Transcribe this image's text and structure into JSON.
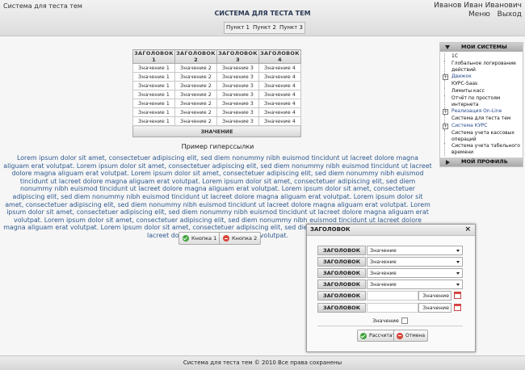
{
  "header": {
    "app_name": "Система для теста тем",
    "system_title": "СИСТЕМА ДЛЯ ТЕСТА ТЕМ",
    "nav": [
      "Пункт 1",
      "Пункт 2",
      "Пункт 3"
    ],
    "user_name": "Иванов Иван Иванович",
    "menu_label": "Меню",
    "exit_label": "Выход"
  },
  "table": {
    "headers": [
      "ЗАГОЛОВОК 1",
      "ЗАГОЛОВОК 2",
      "ЗАГОЛОВОК 3",
      "ЗАГОЛОВОК 4"
    ],
    "rows": [
      [
        "Значение 1",
        "Значение 2",
        "Значение 3",
        "Значение 4"
      ],
      [
        "Значение 1",
        "Значение 2",
        "Значение 3",
        "Значение 4"
      ],
      [
        "Значение 1",
        "Значение 2",
        "Значение 3",
        "Значение 4"
      ],
      [
        "Значение 1",
        "Значение 2",
        "Значение 3",
        "Значение 4"
      ],
      [
        "Значение 1",
        "Значение 2",
        "Значение 3",
        "Значение 4"
      ],
      [
        "Значение 1",
        "Значение 2",
        "Значение 3",
        "Значение 4"
      ],
      [
        "Значение 1",
        "Значение 2",
        "Значение 3",
        "Значение 4"
      ]
    ],
    "footer": "ЗНАЧЕНИЕ"
  },
  "hyperlink": "Пример гиперссылки",
  "lorem": "Lorem ipsum dolor sit amet, consectetuer adipiscing elit, sed diem nonummy nibh euismod tincidunt ut lacreet dolore magna aliguam erat volutpat. Lorem ipsum dolor sit amet, consectetuer adipiscing elit, sed diem nonummy nibh euismod tincidunt ut lacreet dolore magna aliguam erat volutpat. Lorem ipsum dolor sit amet, consectetuer adipiscing elit, sed diem nonummy nibh euismod tincidunt ut lacreet dolore magna aliguam erat volutpat. Lorem ipsum dolor sit amet, consectetuer adipiscing elit, sed diem nonummy nibh euismod tincidunt ut lacreet dolore magna aliguam erat volutpat. Lorem ipsum dolor sit amet, consectetuer adipiscing elit, sed diem nonummy nibh euismod tincidunt ut lacreet dolore magna aliguam erat volutpat. Lorem ipsum dolor sit amet, consectetuer adipiscing elit, sed diem nonummy nibh euismod tincidunt ut lacreet dolore magna aliguam erat volutpat. Lorem ipsum dolor sit amet, consectetuer adipiscing elit, sed diem nonummy nibh euismod tincidunt ut lacreet dolore magna aliguam erat volutpat. Lorem ipsum dolor sit amet, consectetuer adipiscing elit, sed diem nonummy nibh euismod tincidunt ut lacreet dolore magna aliguam erat volutpat. Lorem ipsum dolor sit amet, consectetuer adipiscing elit, sed diem nonummy nibh euismod tincidunt ut lacreet dolore magna aliguam erat volutpat.",
  "buttons": {
    "button1": "Кнопка 1",
    "button2": "Кнопка 2"
  },
  "sidebar": {
    "my_systems": "МОИ СИСТЕМЫ",
    "items": [
      {
        "label": "1С",
        "link": false,
        "expandable": false
      },
      {
        "label": "Глобальное логирование действий",
        "link": false,
        "expandable": false
      },
      {
        "label": "Движок",
        "link": true,
        "expandable": true
      },
      {
        "label": "КУРС-Saas",
        "link": false,
        "expandable": false
      },
      {
        "label": "Лимиты касс",
        "link": false,
        "expandable": false
      },
      {
        "label": "Отчёт по простоям интернета",
        "link": false,
        "expandable": false
      },
      {
        "label": "Реализация On-Line",
        "link": true,
        "expandable": true
      },
      {
        "label": "Система для теста тем",
        "link": false,
        "expandable": false
      },
      {
        "label": "Система КУРС",
        "link": true,
        "expandable": true
      },
      {
        "label": "Система учета кассовых операций",
        "link": false,
        "expandable": false
      },
      {
        "label": "Система учета табельного времени",
        "link": false,
        "expandable": false
      }
    ],
    "my_profile": "МОЙ ПРОФИЛЬ"
  },
  "dialog": {
    "title": "ЗАГОЛОВОК",
    "rows": [
      {
        "label": "ЗАГОЛОВОК",
        "value": "Значение"
      },
      {
        "label": "ЗАГОЛОВОК",
        "value": "Значение"
      },
      {
        "label": "ЗАГОЛОВОК",
        "value": "Значение"
      },
      {
        "label": "ЗАГОЛОВОК",
        "value": "Значение"
      }
    ],
    "date_rows": [
      {
        "label": "ЗАГОЛОВОК",
        "value": "Значение"
      },
      {
        "label": "ЗАГОЛОВОК",
        "value": "Значение"
      }
    ],
    "checkbox_label": "Значение",
    "calc_button": "Рассчитать",
    "cancel_button": "Отмена"
  },
  "footer": "Система для теста тем © 2010 Все права сохранены"
}
